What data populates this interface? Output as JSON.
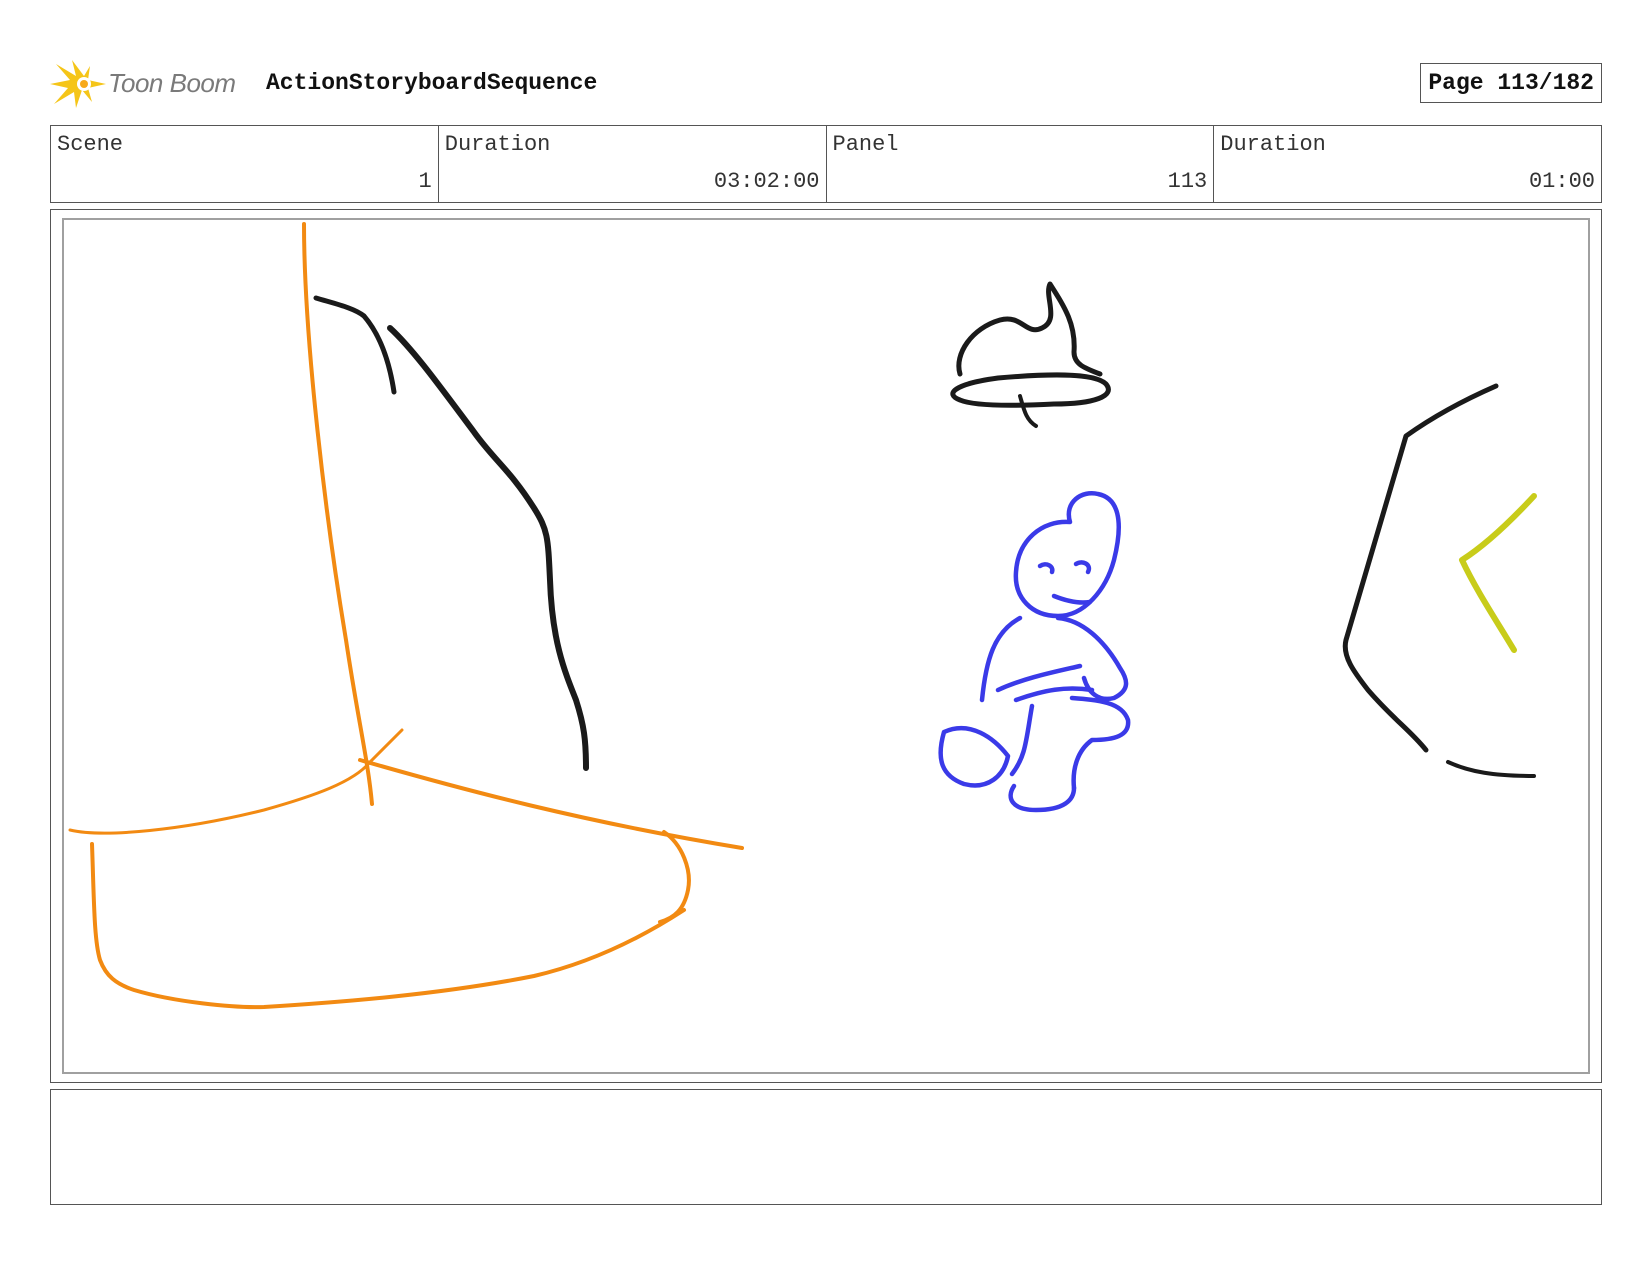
{
  "header": {
    "logo_text": "Toon Boom",
    "sequence_title": "ActionStoryboardSequence",
    "page_label": "Page 113/182"
  },
  "info": [
    {
      "label": "Scene",
      "value": "1"
    },
    {
      "label": "Duration",
      "value": "03:02:00"
    },
    {
      "label": "Panel",
      "value": "113"
    },
    {
      "label": "Duration",
      "value": "01:00"
    }
  ],
  "notes": {
    "text": ""
  },
  "colors": {
    "orange_stroke": "#f28a12",
    "black_stroke": "#1a1a1a",
    "blue_stroke": "#3a3ae8",
    "yellow_stroke": "#c8cc1a",
    "logo_star": "#f5c518",
    "border": "#555555"
  }
}
